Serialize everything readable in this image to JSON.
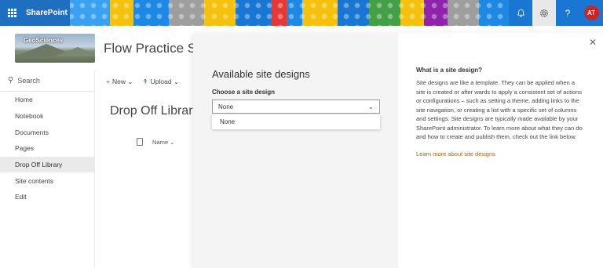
{
  "suitebar": {
    "brand": "SharePoint",
    "avatar_initials": "AT",
    "help_glyph": "?"
  },
  "site": {
    "logo_text": "GeoSciences",
    "title": "Flow Practice Site"
  },
  "leftnav": {
    "search_label": "Search",
    "items": [
      "Home",
      "Notebook",
      "Documents",
      "Pages",
      "Drop Off Library",
      "Site contents",
      "Edit"
    ],
    "active_index": 4
  },
  "commandbar": {
    "new_label": "New",
    "upload_label": "Upload"
  },
  "library": {
    "title": "Drop Off Library",
    "name_column": "Name"
  },
  "panel": {
    "title": "Available site designs",
    "choose_label": "Choose a site design",
    "selected_value": "None",
    "options": [
      "None"
    ],
    "info_title": "What is a site design?",
    "info_body": "Site designs are like a template. They can be applied when a site is created or after wards to apply a consistent set of actions or configurations – such as setting a theme, adding links to the site navigation, or creating a list with a specific set of columns and settings. Site designs are typically made available by your SharePoint administrator. To learn more about what they can do and how to create and publish them, check out the link below.",
    "learn_more": "Learn more about site designs"
  },
  "icons": [
    "waffle-icon",
    "bell-icon",
    "gear-icon",
    "help-icon",
    "search-icon",
    "plus-icon",
    "upload-icon",
    "chevron-down-icon",
    "document-icon",
    "close-icon"
  ],
  "colors": {
    "brand_blue": "#1f6fc1",
    "link_orange": "#a0681d",
    "avatar_red": "#c62828",
    "panel_gray": "#f4f4f4"
  }
}
